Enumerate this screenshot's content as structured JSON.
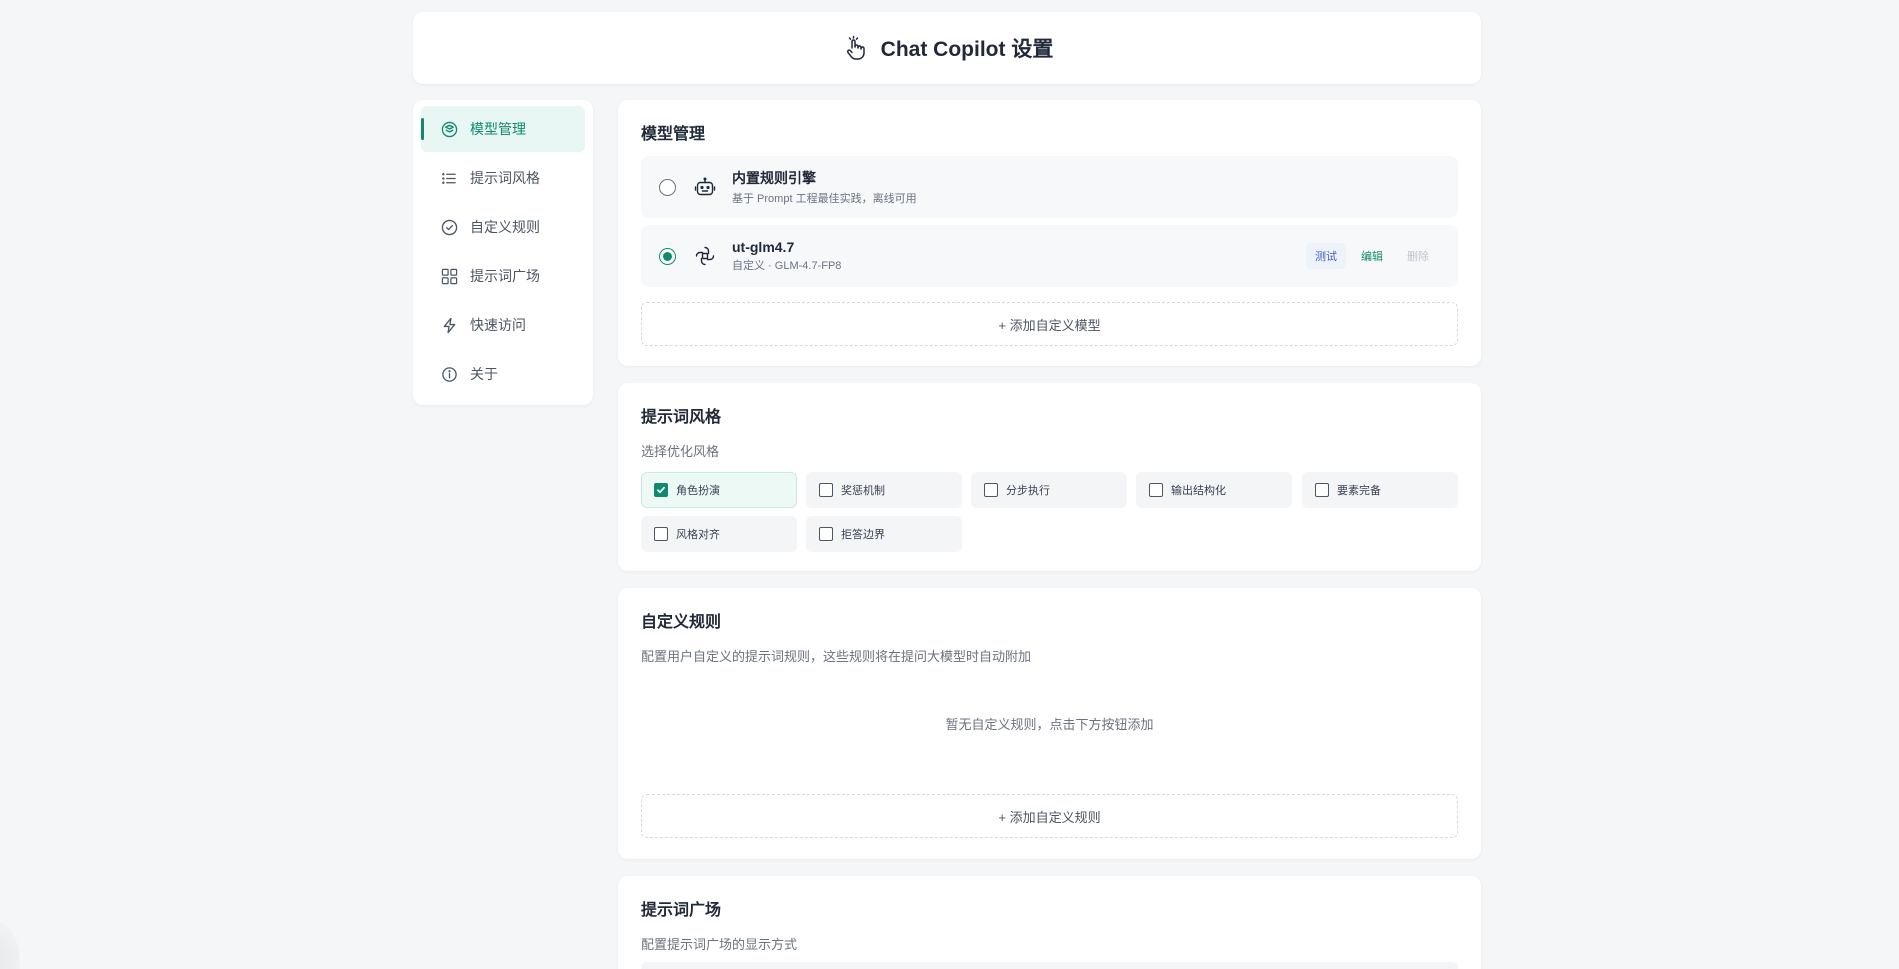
{
  "header": {
    "title": "Chat Copilot 设置",
    "icon": "tap-hand-icon"
  },
  "sidebar": {
    "items": [
      {
        "label": "模型管理",
        "icon": "layers-icon",
        "active": true
      },
      {
        "label": "提示词风格",
        "icon": "list-icon",
        "active": false
      },
      {
        "label": "自定义规则",
        "icon": "check-circle-icon",
        "active": false
      },
      {
        "label": "提示词广场",
        "icon": "grid-icon",
        "active": false
      },
      {
        "label": "快速访问",
        "icon": "bolt-icon",
        "active": false
      },
      {
        "label": "关于",
        "icon": "info-icon",
        "active": false
      }
    ]
  },
  "models_section": {
    "title": "模型管理",
    "models": [
      {
        "name": "内置规则引擎",
        "subtitle": "基于 Prompt 工程最佳实践，离线可用",
        "selected": false,
        "icon": "robot-icon"
      },
      {
        "name": "ut-glm4.7",
        "subtitle": "自定义 · GLM-4.7-FP8",
        "selected": true,
        "icon": "network-icon",
        "actions": {
          "test": "测试",
          "edit": "编辑",
          "delete": "删除"
        }
      }
    ],
    "add_label": "+ 添加自定义模型"
  },
  "style_section": {
    "title": "提示词风格",
    "subtitle": "选择优化风格",
    "options": [
      {
        "label": "角色扮演",
        "checked": true
      },
      {
        "label": "奖惩机制",
        "checked": false
      },
      {
        "label": "分步执行",
        "checked": false
      },
      {
        "label": "输出结构化",
        "checked": false
      },
      {
        "label": "要素完备",
        "checked": false
      },
      {
        "label": "风格对齐",
        "checked": false
      },
      {
        "label": "拒答边界",
        "checked": false
      }
    ]
  },
  "rules_section": {
    "title": "自定义规则",
    "description": "配置用户自定义的提示词规则，这些规则将在提问大模型时自动附加",
    "empty_text": "暂无自定义规则，点击下方按钮添加",
    "add_label": "+ 添加自定义规则"
  },
  "square_section": {
    "title": "提示词广场",
    "description": "配置提示词广场的显示方式"
  },
  "colors": {
    "accent": "#10896f",
    "accent_bg": "#e8f7f3",
    "page_bg": "#f5f6f8",
    "test_blue": "#3b5fc4"
  }
}
